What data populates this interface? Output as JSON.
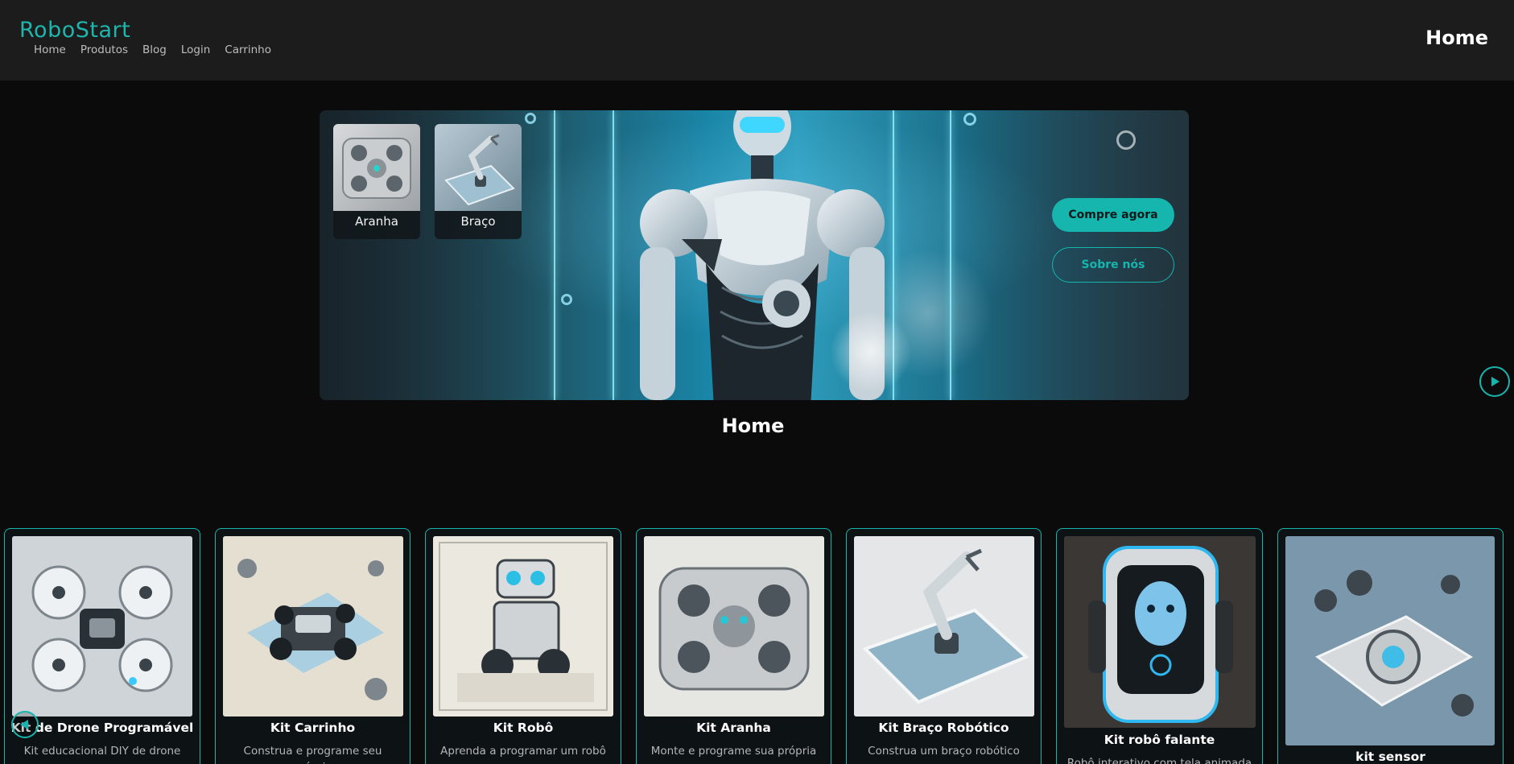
{
  "header": {
    "brand": "RoboStart",
    "nav": [
      "Home",
      "Produtos",
      "Blog",
      "Login",
      "Carrinho"
    ],
    "title": "Home"
  },
  "hero": {
    "thumbnails": [
      {
        "label": "Aranha",
        "icon": "spider-kit-image"
      },
      {
        "label": "Braço",
        "icon": "robotic-arm-image"
      }
    ],
    "primary_button": "Compre agora",
    "secondary_button": "Sobre nós",
    "next_icon": "play-icon"
  },
  "section": {
    "title": "Home"
  },
  "products": [
    {
      "title": "Kit de Drone Programável",
      "desc": "Kit educacional DIY de drone para"
    },
    {
      "title": "Kit Carrinho",
      "desc": "Construa e programe seu próprio"
    },
    {
      "title": "Kit Robô",
      "desc": "Aprenda a programar um robô"
    },
    {
      "title": "Kit Aranha",
      "desc": "Monte e programe sua própria"
    },
    {
      "title": "Kit Braço Robótico",
      "desc": "Construa um braço robótico"
    },
    {
      "title": "Kit robô falante",
      "desc": "Robô interativo com tela animada"
    },
    {
      "title": "kit sensor",
      "desc": ""
    }
  ],
  "colors": {
    "accent": "#16b5ad",
    "header_bg": "#1c1c1c",
    "page_bg": "#0b0b0b"
  }
}
